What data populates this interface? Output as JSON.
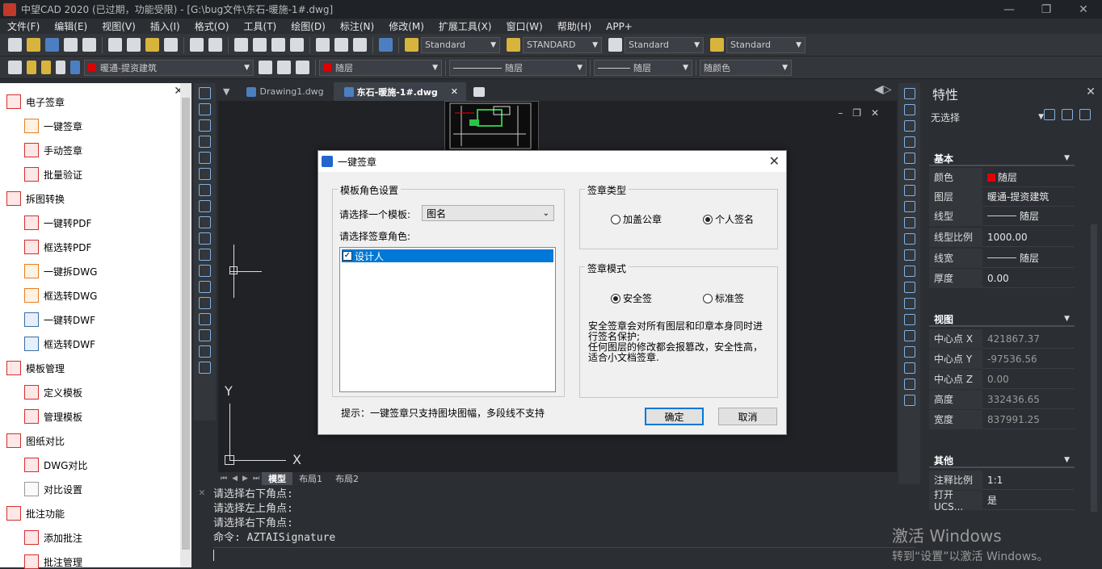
{
  "app": {
    "title": "中望CAD 2020 (已过期，功能受限) - [G:\\bug文件\\东石-暖施-1#.dwg]"
  },
  "window_controls": {
    "minimize": "—",
    "restore": "❐",
    "close": "✕"
  },
  "menu": [
    "文件(F)",
    "编辑(E)",
    "视图(V)",
    "插入(I)",
    "格式(O)",
    "工具(T)",
    "绘图(D)",
    "标注(N)",
    "修改(M)",
    "扩展工具(X)",
    "窗口(W)",
    "帮助(H)",
    "APP+"
  ],
  "toolbar1": {
    "text_style": "Standard",
    "dim_style": "STANDARD",
    "table_style": "Standard",
    "mleader_style": "Standard"
  },
  "toolbar2": {
    "layer": "暖通-提资建筑",
    "color": "随层",
    "linetype": "随层",
    "lineweight": "随层",
    "plotstyle": "随颜色"
  },
  "left_panel": {
    "sections": [
      {
        "title": "电子签章",
        "items": [
          "一键签章",
          "手动签章",
          "批量验证"
        ]
      },
      {
        "title": "拆图转换",
        "items": [
          "一键转PDF",
          "框选转PDF",
          "一键拆DWG",
          "框选转DWG",
          "一键转DWF",
          "框选转DWF"
        ]
      },
      {
        "title": "模板管理",
        "items": [
          "定义模板",
          "管理模板"
        ]
      },
      {
        "title": "图纸对比",
        "items": [
          "DWG对比",
          "对比设置"
        ]
      },
      {
        "title": "批注功能",
        "items": [
          "添加批注",
          "批注管理"
        ]
      }
    ]
  },
  "doc_tabs": [
    {
      "label": "Drawing1.dwg",
      "active": false
    },
    {
      "label": "东石-暖施-1#.dwg",
      "active": true,
      "close": "✕"
    }
  ],
  "canvas": {
    "axis_x": "X",
    "axis_y": "Y"
  },
  "layout_tabs": [
    {
      "label": "模型",
      "active": true
    },
    {
      "label": "布局1",
      "active": false
    },
    {
      "label": "布局2",
      "active": false
    }
  ],
  "command_line": {
    "lines": [
      "请选择右下角点:",
      "请选择左上角点:",
      "请选择右下角点:",
      "命令: AZTAISignature"
    ]
  },
  "properties": {
    "title": "特性",
    "selection": "无选择",
    "sections": {
      "basic": {
        "title": "基本",
        "rows": [
          {
            "key": "颜色",
            "value": "随层",
            "swatch": "#e00000"
          },
          {
            "key": "图层",
            "value": "暖通-提资建筑"
          },
          {
            "key": "线型",
            "value": "随层"
          },
          {
            "key": "线型比例",
            "value": "1000.00"
          },
          {
            "key": "线宽",
            "value": "随层"
          },
          {
            "key": "厚度",
            "value": "0.00"
          }
        ]
      },
      "view": {
        "title": "视图",
        "rows": [
          {
            "key": "中心点 X",
            "value": "421867.37"
          },
          {
            "key": "中心点 Y",
            "value": "-97536.56"
          },
          {
            "key": "中心点 Z",
            "value": "0.00"
          },
          {
            "key": "高度",
            "value": "332436.65"
          },
          {
            "key": "宽度",
            "value": "837991.25"
          }
        ]
      },
      "other": {
        "title": "其他",
        "rows": [
          {
            "key": "注释比例",
            "value": "1:1"
          },
          {
            "key": "打开 UCS...",
            "value": "是"
          }
        ]
      }
    }
  },
  "watermark": {
    "line1": "激活 Windows",
    "line2": "转到“设置”以激活 Windows。"
  },
  "dialog": {
    "title": "一键签章",
    "template_group": "模板角色设置",
    "template_label": "请选择一个模板:",
    "template_value": "图名",
    "role_label": "请选择签章角色:",
    "roles": [
      {
        "label": "设计人",
        "checked": true
      }
    ],
    "type_group": "签章类型",
    "type_options": [
      {
        "label": "加盖公章",
        "selected": false
      },
      {
        "label": "个人签名",
        "selected": true
      }
    ],
    "mode_group": "签章模式",
    "mode_options": [
      {
        "label": "安全签",
        "selected": true
      },
      {
        "label": "标准签",
        "selected": false
      }
    ],
    "mode_desc": [
      "安全签章会对所有图层和印章本身同时进",
      "行签名保护;",
      "任何图层的修改都会报篡改，安全性高，",
      "适合小文档签章."
    ],
    "hint": "提示：一键签章只支持图块图幅，多段线不支持",
    "ok": "确定",
    "cancel": "取消"
  }
}
